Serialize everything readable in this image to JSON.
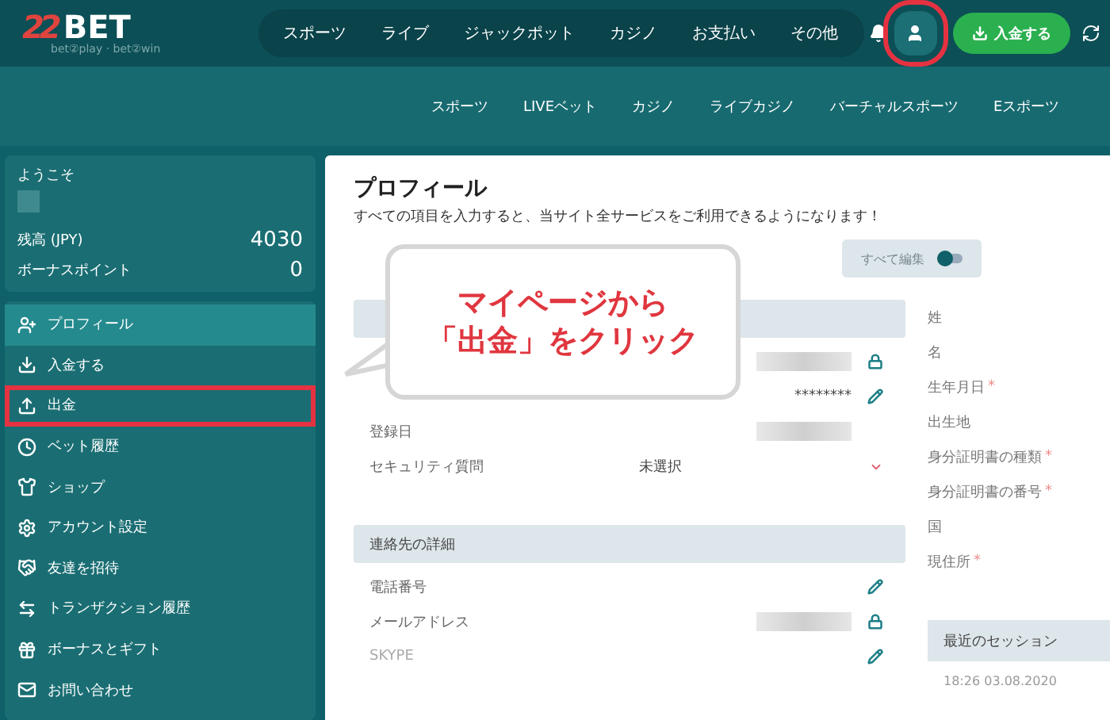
{
  "logo": {
    "mark": "22",
    "word": "BET",
    "tagline": "bet②play · bet②win"
  },
  "top_nav": [
    "スポーツ",
    "ライブ",
    "ジャックポット",
    "カジノ",
    "お支払い",
    "その他"
  ],
  "header_actions": {
    "account_selected": true,
    "account_annotated": true,
    "deposit": "入金する"
  },
  "sub_nav": [
    "スポーツ",
    "LIVEベット",
    "カジノ",
    "ライブカジノ",
    "バーチャルスポーツ",
    "Eスポーツ"
  ],
  "account": {
    "greeting": "ようこそ",
    "balance_label": "残高 (JPY)",
    "balance": "4030",
    "bonus_label": "ボーナスポイント",
    "bonus": "0"
  },
  "sidebar": {
    "items": [
      {
        "label": "プロフィール",
        "selected": true
      },
      {
        "label": "入金する",
        "selected": false
      },
      {
        "label": "出金",
        "selected": false,
        "annotated": true
      },
      {
        "label": "ベット履歴",
        "selected": false
      },
      {
        "label": "ショップ",
        "selected": false
      },
      {
        "label": "アカウント設定",
        "selected": false
      },
      {
        "label": "友達を招待",
        "selected": false
      },
      {
        "label": "トランザクション履歴",
        "selected": false
      },
      {
        "label": "ボーナスとギフト",
        "selected": false
      },
      {
        "label": "お問い合わせ",
        "selected": false
      }
    ]
  },
  "profile": {
    "title": "プロフィール",
    "subtitle": "すべての項目を入力すると、当サイト全サービスをご利用できるようになります！",
    "edit_all": {
      "label": "すべて編集",
      "on": false
    },
    "sections": [
      {
        "rows": [
          {
            "kind": "locked"
          },
          {
            "kind": "edit",
            "value": "********"
          },
          {
            "kind": "blurred",
            "label": "登録日"
          },
          {
            "kind": "select",
            "label": "セキュリティ質問",
            "value": "未選択"
          }
        ]
      },
      {
        "title": "連絡先の詳細",
        "rows": [
          {
            "kind": "edit",
            "label": "電話番号"
          },
          {
            "kind": "locked",
            "label": "メールアドレス"
          },
          {
            "kind": "edit",
            "label": "SKYPE",
            "disabled": true
          }
        ]
      }
    ],
    "required_mark": "*",
    "personal": [
      {
        "label": "姓",
        "required": false
      },
      {
        "label": "名",
        "required": false
      },
      {
        "label": "生年月日",
        "required": true
      },
      {
        "label": "出生地",
        "required": false
      },
      {
        "label": "身分証明書の種類",
        "required": true
      },
      {
        "label": "身分証明書の番号",
        "required": true
      },
      {
        "label": "国",
        "required": false
      },
      {
        "label": "現住所",
        "required": true
      }
    ],
    "session": {
      "title": "最近のセッション",
      "time": "18:26 03.08.2020"
    }
  },
  "callout": {
    "lines": [
      "マイページから",
      "「出金」をクリック"
    ]
  }
}
